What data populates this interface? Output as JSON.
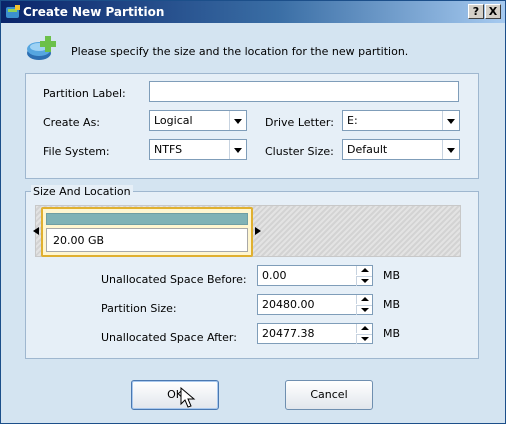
{
  "window": {
    "title": "Create New Partition",
    "help_label": "?",
    "close_label": "X"
  },
  "header": {
    "instruction": "Please specify the size and the location for the new partition."
  },
  "form": {
    "partition_label_label": "Partition Label:",
    "partition_label_value": "",
    "create_as_label": "Create As:",
    "create_as_value": "Logical",
    "drive_letter_label": "Drive Letter:",
    "drive_letter_value": "E:",
    "file_system_label": "File System:",
    "file_system_value": "NTFS",
    "cluster_size_label": "Cluster Size:",
    "cluster_size_value": "Default"
  },
  "size_location": {
    "group_title": "Size And Location",
    "partition_size_display": "20.00 GB",
    "unallocated_before_label": "Unallocated Space Before:",
    "unallocated_before_value": "0.00",
    "partition_size_label": "Partition Size:",
    "partition_size_value": "20480.00",
    "unallocated_after_label": "Unallocated Space After:",
    "unallocated_after_value": "20477.38",
    "unit": "MB"
  },
  "buttons": {
    "ok_label": "OK",
    "cancel_label": "Cancel"
  },
  "icons": {
    "title_icon": "partition-wizard-icon",
    "header_icon": "create-partition-icon"
  }
}
